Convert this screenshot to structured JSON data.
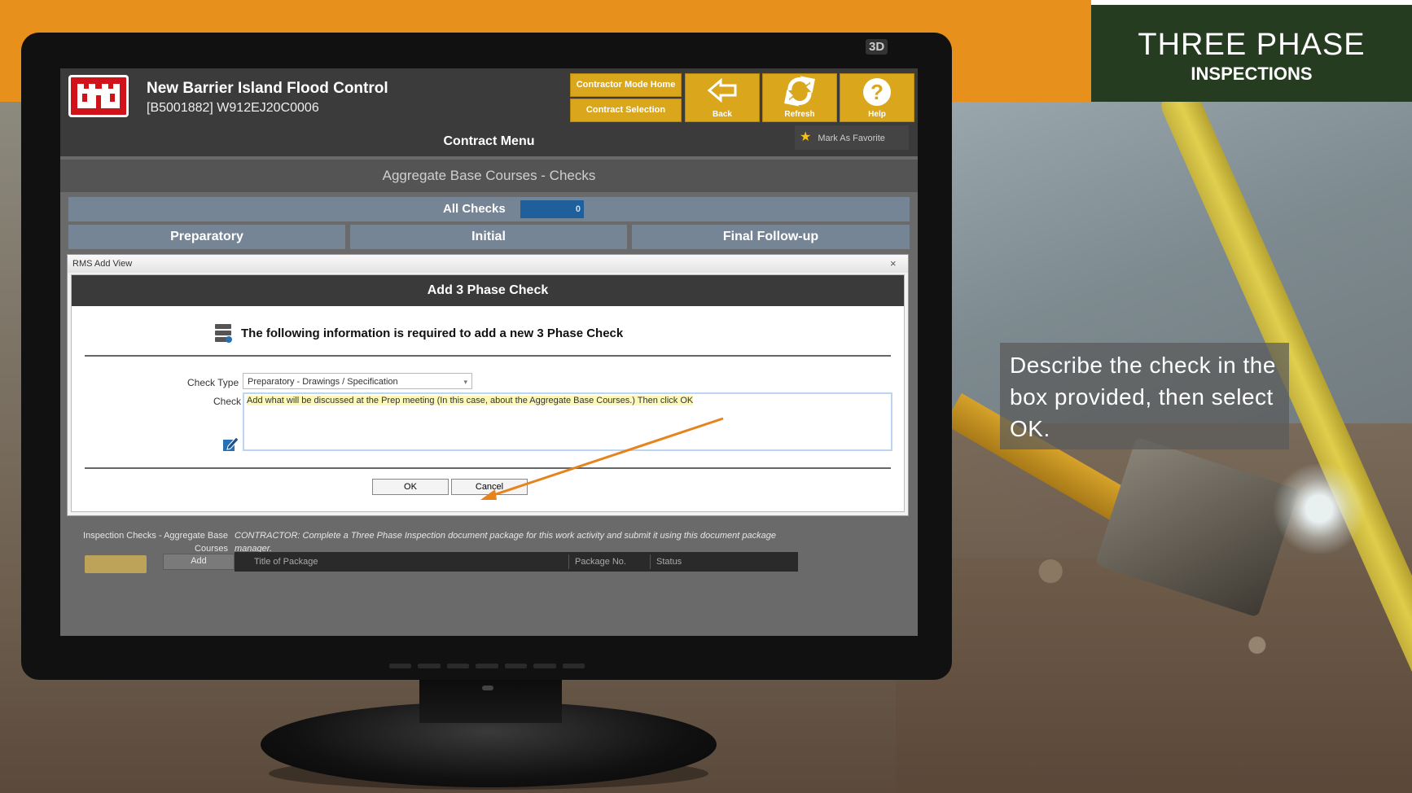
{
  "overlay": {
    "title_main": "THREE PHASE",
    "title_sub": "INSPECTIONS",
    "instruction": "Describe the check in the box provided, then select OK."
  },
  "monitor": {
    "badge": "3D"
  },
  "app": {
    "project_name": "New Barrier Island Flood Control",
    "project_code": "[B5001882] W912EJ20C0006",
    "buttons": {
      "contractor_home": "Contractor Mode Home",
      "contract_selection": "Contract Selection",
      "back": "Back",
      "refresh": "Refresh",
      "help": "Help"
    },
    "contract_menu": "Contract Menu",
    "favorite": "Mark As Favorite",
    "section_title": "Aggregate Base Courses  - Checks",
    "all_checks": {
      "label": "All Checks",
      "count": "0"
    },
    "tabs": [
      "Preparatory",
      "Initial",
      "Final Follow-up"
    ]
  },
  "modal": {
    "window_title": "RMS Add View",
    "close": "×",
    "header": "Add 3 Phase Check",
    "info": "The following information is required to add a new 3 Phase Check",
    "check_type_label": "Check Type",
    "check_type_value": "Preparatory - Drawings / Specification",
    "check_label": "Check",
    "check_text": "Add what will be discussed at the Prep meeting (In this case, about the Aggregate Base Courses.) Then click OK",
    "ok": "OK",
    "cancel": "Cancel"
  },
  "bottom": {
    "inspection_label": "Inspection Checks - Aggregate Base Courses",
    "contractor_note": "CONTRACTOR: Complete a Three Phase Inspection document package for this work activity and submit it using this document package manager.",
    "add": "Add",
    "columns": [
      "Title of Package",
      "Package No.",
      "Status"
    ]
  },
  "colors": {
    "orange": "#e8901c",
    "title_green": "#263c21",
    "button_gold": "#d9a61c",
    "arrow": "#e8821c"
  }
}
